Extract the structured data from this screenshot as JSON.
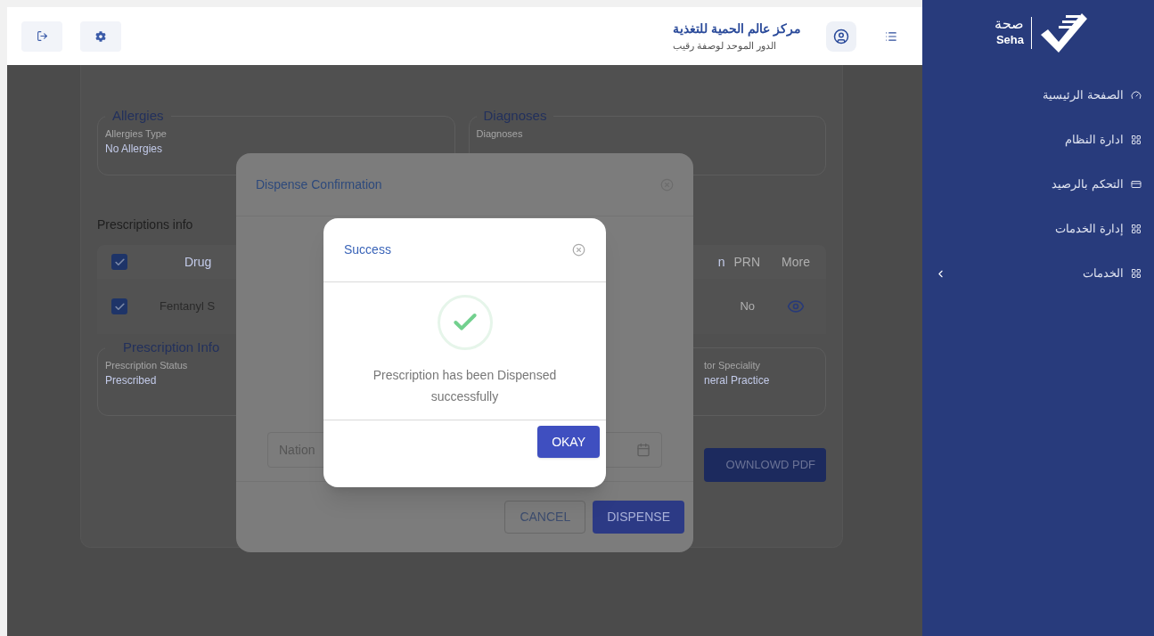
{
  "header": {
    "title": "مركز عالم الحمية للتغذية",
    "subtitle": "الدور الموحد لوصفة رقيب"
  },
  "sidebar": {
    "logo": {
      "arabic": "صحة",
      "latin": "Seha"
    },
    "items": [
      {
        "label": "الصفحة الرئيسية",
        "kind": "dashboard",
        "expandable": false
      },
      {
        "label": "ادارة النظام",
        "kind": "section",
        "expandable": false
      },
      {
        "label": "التحكم بالرصيد",
        "kind": "balance",
        "expandable": false
      },
      {
        "label": "إدارة الخدمات",
        "kind": "section",
        "expandable": false
      },
      {
        "label": "الخدمات",
        "kind": "section",
        "expandable": true
      }
    ]
  },
  "record": {
    "allergies": {
      "title": "Allergies",
      "label": "Allergies Type",
      "value": "No Allergies"
    },
    "diagnoses": {
      "title": "Diagnoses",
      "label": "Diagnoses"
    },
    "prescriptions": {
      "title": "Prescriptions info",
      "header_checked": true,
      "columns": [
        "Drug",
        "n",
        "PRN",
        "More"
      ],
      "rows": [
        {
          "checked": true,
          "drug": "Fentanyl S",
          "prn": "No"
        }
      ]
    },
    "prescription_info": {
      "title": "Prescription Info",
      "status_label": "Prescription Status",
      "status_value": "Prescribed",
      "speciality_label": "tor Speciality",
      "speciality_value": "neral Practice"
    },
    "download_button": "OWNLOWD PDF"
  },
  "dispense_dialog": {
    "title": "Dispense Confirmation",
    "field_placeholder": "Nation",
    "buttons": [
      {
        "label": "CANCEL",
        "kind": "outline"
      },
      {
        "label": "DISPENSE",
        "kind": "filled"
      }
    ]
  },
  "success_dialog": {
    "title": "Success",
    "message": "Prescription has been Dispensed successfully",
    "button": "OKAY"
  }
}
